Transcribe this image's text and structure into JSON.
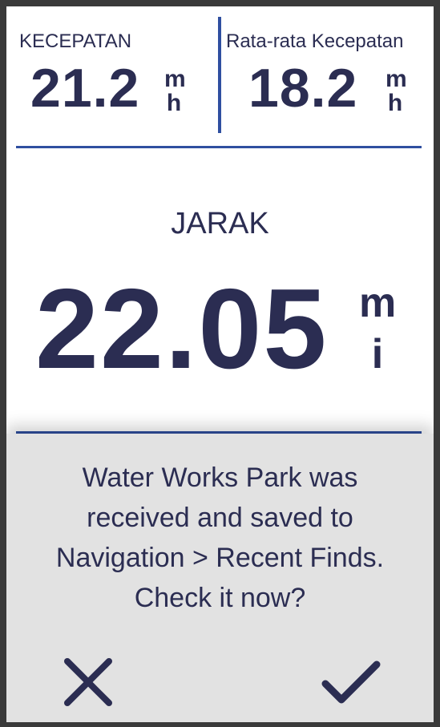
{
  "speed": {
    "label": "KECEPATAN",
    "value": "21.2",
    "unit_top": "m",
    "unit_bottom": "h"
  },
  "avg_speed": {
    "label": "Rata-rata Kecepatan",
    "value": "18.2",
    "unit_top": "m",
    "unit_bottom": "h"
  },
  "distance": {
    "label": "JARAK",
    "value": "22.05",
    "unit_top": "m",
    "unit_bottom": "i"
  },
  "toast": {
    "lines": [
      "Water Works Park was",
      "received and saved to",
      "Navigation > Recent Finds.",
      "Check it now?"
    ],
    "cancel_icon": "close-icon",
    "confirm_icon": "checkmark-icon"
  },
  "colors": {
    "text": "#2b2d52",
    "accent": "#2f4fa0",
    "toast_bg": "#e2e2e2"
  }
}
